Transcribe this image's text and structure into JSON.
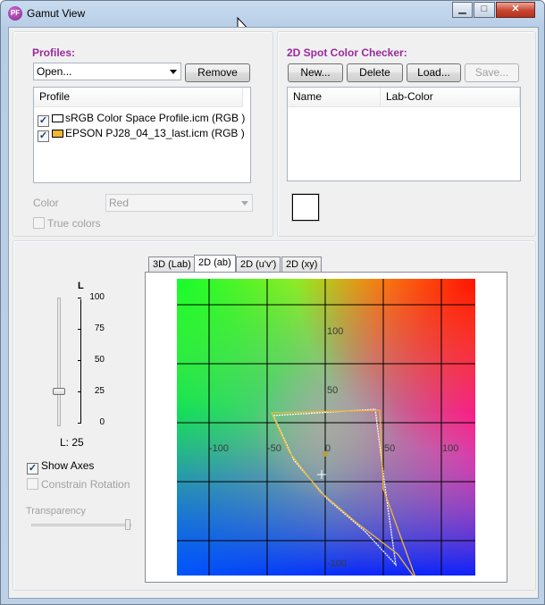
{
  "window": {
    "title": "Gamut View",
    "icon": "pf-app-icon"
  },
  "caption_buttons": {
    "minimize": "▁",
    "maximize": "□",
    "close": "✕"
  },
  "profiles": {
    "title": "Profiles:",
    "open_combo": "Open...",
    "remove_button": "Remove",
    "list_header": "Profile",
    "items": [
      {
        "label": "sRGB Color Space Profile.icm (RGB )",
        "checked": true,
        "swatch_color": "#ffffff"
      },
      {
        "label": "EPSON PJ28_04_13_last.icm (RGB )",
        "checked": true,
        "swatch_color": "#f2b730"
      }
    ],
    "color_label": "Color",
    "color_value": "Red",
    "true_colors_label": "True colors"
  },
  "spot_checker": {
    "title": "2D Spot Color Checker:",
    "new_button": "New...",
    "delete_button": "Delete",
    "load_button": "Load...",
    "save_button": "Save...",
    "col_name": "Name",
    "col_lab": "Lab-Color",
    "swatch_color": "#ffffff"
  },
  "view": {
    "tabs": [
      "3D (Lab)",
      "2D (ab)",
      "2D (u'v')",
      "2D (xy)"
    ],
    "active_tab": "2D (ab)",
    "slider_axis_label": "L",
    "slider_ticks": [
      "100",
      "75",
      "50",
      "25",
      "0"
    ],
    "slider_value_text": "L: 25",
    "l_value": 25,
    "show_axes_label": "Show Axes",
    "show_axes_checked": true,
    "constrain_rotation_label": "Constrain Rotation",
    "transparency_label": "Transparency",
    "plot_labels": {
      "top100": "100",
      "top50": "50",
      "left100": "-100",
      "left50": "-50",
      "zero": "0",
      "right50": "50",
      "right100": "100",
      "bottom100": "-100"
    },
    "srgb_color": "#ffffff",
    "epson_color": "#f2b730"
  }
}
